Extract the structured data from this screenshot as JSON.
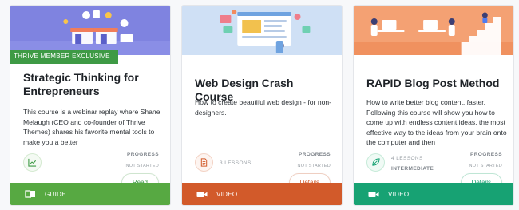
{
  "colors": {
    "guide_footer": "#57a942",
    "video_footer_orange": "#d25a2a",
    "video_footer_green": "#17a273",
    "read_button": "#3e9a45",
    "details_orange": "#d25a2a",
    "details_green": "#17a273",
    "ribbon": "#3e9a45"
  },
  "cards": [
    {
      "ribbon": "THRIVE MEMBER EXCLUSIVE",
      "title": "Strategic Thinking for Entrepreneurs",
      "description": "This course is a webinar replay where Shane Melaugh (CEO and co-founder of Thrive Themes) shares his favorite mental tools to make you a better",
      "icon": "chart-trend-icon",
      "progress_label": "PROGRESS",
      "progress_value": "NOT STARTED",
      "button": "Read",
      "footer_icon": "book-icon",
      "footer_label": "GUIDE"
    },
    {
      "title": "Web Design Crash Course",
      "description": "How to create beautiful web design - for non-designers.",
      "icon": "document-icon",
      "lessons": "3 LESSONS",
      "progress_label": "PROGRESS",
      "progress_value": "NOT STARTED",
      "button": "Details",
      "footer_icon": "video-camera-icon",
      "footer_label": "VIDEO"
    },
    {
      "title": "RAPID Blog Post Method",
      "description": "How to write better blog content, faster. Following this course will show you how to come up with endless content ideas, the most effective way to the ideas from your brain onto the computer and then",
      "icon": "leaf-icon",
      "lessons": "4 LESSONS",
      "level": "INTERMEDIATE",
      "progress_label": "PROGRESS",
      "progress_value": "NOT STARTED",
      "button": "Details",
      "footer_icon": "video-camera-icon",
      "footer_label": "VIDEO"
    }
  ]
}
